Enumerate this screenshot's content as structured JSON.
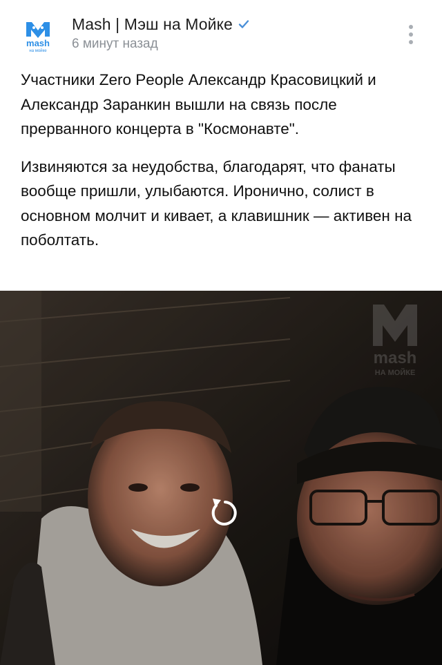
{
  "post": {
    "channel_name": "Mash | Мэш на Мойке",
    "timestamp": "6 минут назад",
    "paragraphs": [
      "Участники Zero People Александр Красовицкий и Александр Заранкин вышли на связь после прерванного концерта в \"Космонавте\".",
      "Извиняются за неудобства, благодарят, что фанаты вообще пришли, улыбаются. Иронично, солист в основном молчит и кивает, а клавишник — активен на поболтать."
    ]
  },
  "avatar": {
    "logo_word": "mash",
    "logo_sub": "на мойке"
  },
  "video": {
    "watermark_word": "mash",
    "watermark_sub": "НА МОЙКЕ"
  },
  "icons": {
    "verified": "verified-check-icon",
    "more": "more-vertical-icon",
    "replay": "replay-icon"
  },
  "colors": {
    "brand": "#2d8fe6",
    "verified": "#4a8fd8",
    "muted_text": "#8a8f95"
  }
}
